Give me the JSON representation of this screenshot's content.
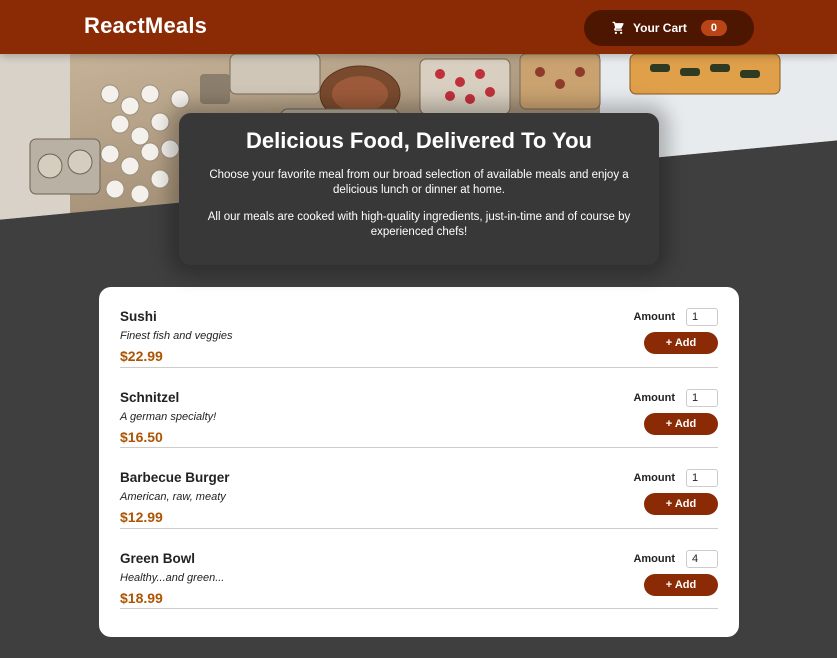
{
  "header": {
    "title": "ReactMeals",
    "cart": {
      "icon": "shopping-cart-icon",
      "label": "Your Cart",
      "count": "0"
    }
  },
  "summary": {
    "heading": "Delicious Food, Delivered To You",
    "paragraph1": "Choose your favorite meal from our broad selection of available meals and enjoy a delicious lunch or dinner at home.",
    "paragraph2": "All our meals are cooked with high-quality ingredients, just-in-time and of course by experienced chefs!"
  },
  "meals": [
    {
      "name": "Sushi",
      "description": "Finest fish and veggies",
      "price": "$22.99",
      "amount_label": "Amount",
      "amount": "1",
      "add_label": "+ Add"
    },
    {
      "name": "Schnitzel",
      "description": "A german specialty!",
      "price": "$16.50",
      "amount_label": "Amount",
      "amount": "1",
      "add_label": "+ Add"
    },
    {
      "name": "Barbecue Burger",
      "description": "American, raw, meaty",
      "price": "$12.99",
      "amount_label": "Amount",
      "amount": "1",
      "add_label": "+ Add"
    },
    {
      "name": "Green Bowl",
      "description": "Healthy...and green...",
      "price": "$18.99",
      "amount_label": "Amount",
      "amount": "4",
      "add_label": "+ Add"
    }
  ],
  "colors": {
    "header_bg": "#8a2b06",
    "cart_bg": "#4d1601",
    "badge_bg": "#b94517",
    "page_bg": "#3f3f3f",
    "summary_bg": "#383838",
    "price": "#ad5502",
    "button": "#8a2b06"
  }
}
